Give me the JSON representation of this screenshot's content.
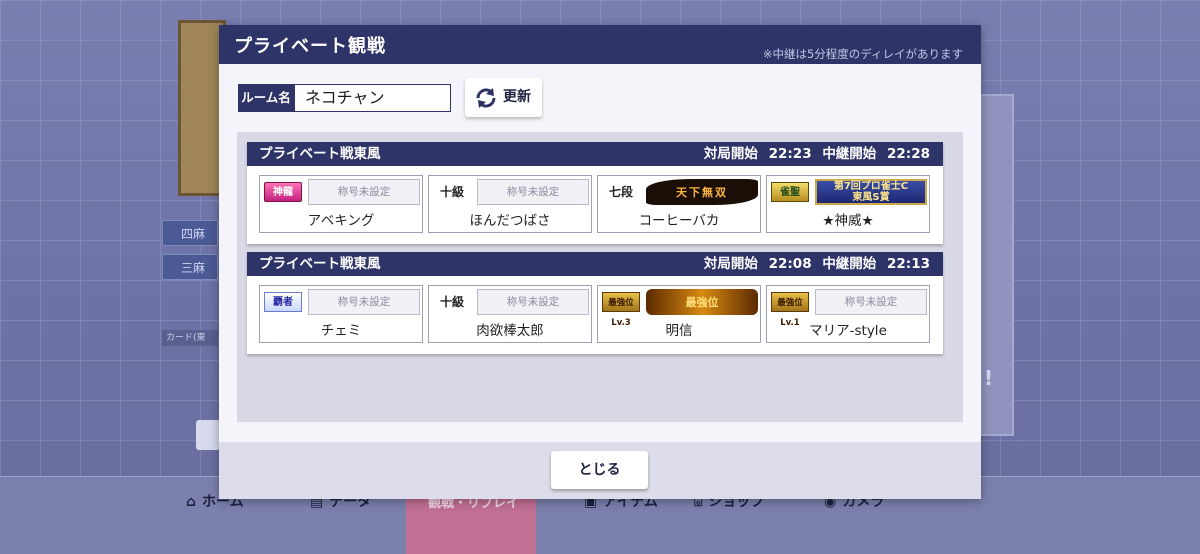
{
  "background": {
    "chip_1": "四麻",
    "chip_2": "三麻",
    "card_label": "カード(東",
    "excl": "!",
    "nav": {
      "home": "ホーム",
      "data": "データ",
      "watch_replay": "観戦・リプレイ",
      "item": "アイテム",
      "shop": "ショップ",
      "camera": "カメラ"
    }
  },
  "modal": {
    "title": "プライベート観戦",
    "delay_note": "※中継は5分程度のディレイがあります",
    "room_label": "ルーム名",
    "room_value": "ネコチャン",
    "refresh_label": "更新",
    "close_label": "とじる",
    "matches": [
      {
        "mode": "プライベート戦東風",
        "start_label": "対局開始",
        "start_time": "22:23",
        "relay_label": "中継開始",
        "relay_time": "22:28",
        "players": [
          {
            "name": "アベキング",
            "rank_badge": "神龍",
            "title": "称号未設定"
          },
          {
            "name": "ほんだつばさ",
            "rank_badge": "十級",
            "title": "称号未設定"
          },
          {
            "name": "コーヒーバカ",
            "rank_badge": "七段",
            "title": "天下無双"
          },
          {
            "name": "★神威★",
            "rank_badge": "雀聖",
            "title_line1": "第7回プロ雀士C",
            "title_line2": "東風S賞"
          }
        ]
      },
      {
        "mode": "プライベート戦東風",
        "start_label": "対局開始",
        "start_time": "22:08",
        "relay_label": "中継開始",
        "relay_time": "22:13",
        "players": [
          {
            "name": "チェミ",
            "rank_badge": "覇者",
            "title": "称号未設定"
          },
          {
            "name": "肉欲棒太郎",
            "rank_badge": "十級",
            "title": "称号未設定"
          },
          {
            "name": "明信",
            "rank_badge": "最強位Lv.3",
            "title": "最強位"
          },
          {
            "name": "マリア-style",
            "rank_badge": "最強位Lv.1",
            "title": "称号未設定"
          }
        ]
      }
    ]
  },
  "colors": {
    "header_navy": "#2f3468",
    "modal_bg": "#eaeaf4",
    "list_bg": "#d9d9e6"
  }
}
